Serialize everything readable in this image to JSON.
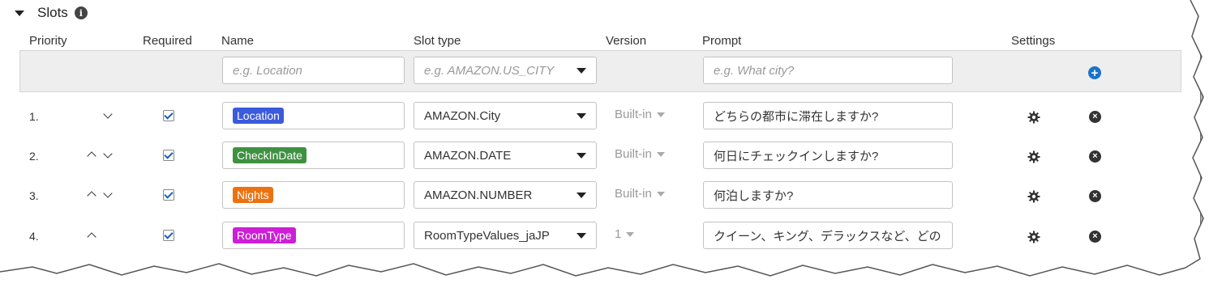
{
  "section": {
    "title": "Slots",
    "info_icon": "info-icon",
    "collapse_icon": "caret-down-icon"
  },
  "columns": {
    "priority": "Priority",
    "required": "Required",
    "name": "Name",
    "slot_type": "Slot type",
    "version": "Version",
    "prompt": "Prompt",
    "settings": "Settings"
  },
  "new_slot": {
    "name_placeholder": "e.g. Location",
    "slot_type_placeholder": "e.g. AMAZON.US_CITY",
    "prompt_placeholder": "e.g. What city?",
    "add_icon": "plus-circle-icon"
  },
  "slots": [
    {
      "priority": "1.",
      "required": true,
      "name": "Location",
      "color": "#3b5bdb",
      "slot_type": "AMAZON.City",
      "version": "Built-in",
      "prompt": "どちらの都市に滞在しますか?"
    },
    {
      "priority": "2.",
      "required": true,
      "name": "CheckInDate",
      "color": "#3f9142",
      "slot_type": "AMAZON.DATE",
      "version": "Built-in",
      "prompt": "何日にチェックインしますか?"
    },
    {
      "priority": "3.",
      "required": true,
      "name": "Nights",
      "color": "#ec7211",
      "slot_type": "AMAZON.NUMBER",
      "version": "Built-in",
      "prompt": "何泊しますか?"
    },
    {
      "priority": "4.",
      "required": true,
      "name": "RoomType",
      "color": "#cc1fd6",
      "slot_type": "RoomTypeValues_jaJP",
      "version": "1",
      "prompt": "クイーン、キング、デラックスなど、どの"
    }
  ],
  "colors": {
    "accent": "#1a73c8",
    "checkbox": "#1a5fb4"
  }
}
